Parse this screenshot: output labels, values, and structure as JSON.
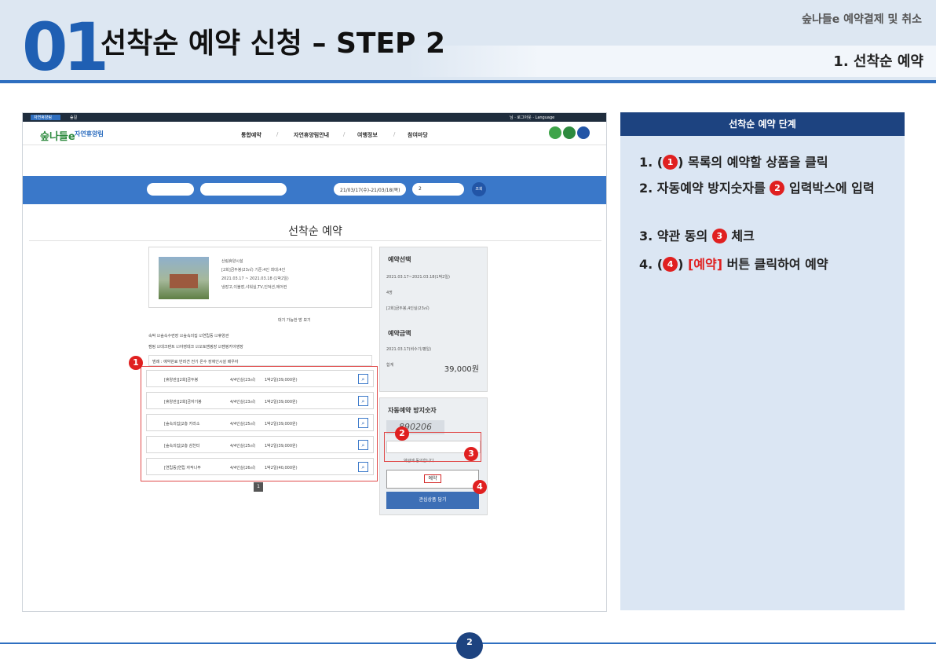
{
  "header": {
    "number": "01",
    "title": "선착순 예약 신청 – STEP 2",
    "subtitle": "숲나들e 예약결제 및 취소",
    "section": "1. 선착순 예약"
  },
  "screenshot": {
    "top_menu": [
      "자연휴양림",
      "숲길"
    ],
    "top_right": "님 · 로그아웃 · Language",
    "logo": "숲나들e",
    "site_name": "자연휴양림",
    "nav": [
      "통합예약",
      "자연휴양림안내",
      "여행정보",
      "참여마당"
    ],
    "search_dates": "21/03/17(수)-21/03/18(목)",
    "search_people": "2",
    "search_button": "조회",
    "page_heading": "선착순 예약",
    "card": {
      "forest_label": "산림휴양시설",
      "facility_label": "시설",
      "facility_value": "[2회]금두봉(23㎡) 기준:4인 최대:4인",
      "stay_label": "숙박기간",
      "stay_value": "2021.03.17 ~ 2021.03.18 (1박2일)",
      "amenity_label": "편의시설",
      "amenity_value": "냉장고,이불장,샤워실,TV,인덕션,에어컨"
    },
    "reservation_select": {
      "heading": "예약선택",
      "use_date_label": "이용일",
      "use_date": "2021.03.17~2021.03.18(1박2일)",
      "people_label": "기준인원",
      "people": "4명",
      "facility_label": "시설",
      "facility": "[2회]금두봉,4인실(23㎡)"
    },
    "reservation_amount": {
      "heading": "예약금액",
      "line": "2021.03.17(비수기/평일)",
      "line_price": "39,000원",
      "total_label": "합계",
      "total": "39,000원"
    },
    "waiting_checkbox": "대기 가능한 방 보기",
    "sort_select": "상품명별순",
    "filter_lodging": "숙박  ☑숲속수련장 ☑숲속의집 ☑연립동 ☑휴양관",
    "filter_camp": "캠핑  ☑데크텐트 ☑야영데크 ☑오토캠핑장 ☑캠핑카야영장",
    "filter_all": "☑전체",
    "legend": "범례 :  예약완료   반려견   전기   온수   장애인시설   배우자",
    "rows": [
      {
        "name": "[휴양관][2회]금두봉",
        "cap": "4/4인실(23㎡)",
        "price": "1박2일(39,000원)"
      },
      {
        "name": "[휴양관][2회]금자기봉",
        "cap": "4/4인실(23㎡)",
        "price": "1박2일(39,000원)"
      },
      {
        "name": "[숲속의집]2층 카라소",
        "cap": "4/4인실(25㎡)",
        "price": "1박2일(39,000원)"
      },
      {
        "name": "[숲속의집]2층 삼천터",
        "cap": "4/4인실(25㎡)",
        "price": "1박2일(39,000원)"
      },
      {
        "name": "[연립동]연립 자작나무",
        "cap": "4/4인실(26㎡)",
        "price": "1박2일(40,000원)"
      }
    ],
    "page": "1",
    "captcha_heading": "자동예약 방지숫자",
    "captcha_value": "890206",
    "agree_text": "약관에 동의합니다.",
    "reserve_button": "예약",
    "cart_button": "관심상품 담기",
    "markers": [
      "1",
      "2",
      "3",
      "4"
    ]
  },
  "panel": {
    "heading": "선착순 예약 단계",
    "steps": [
      {
        "pre": "1. (",
        "badge": "1",
        "post": ") 목록의 예약할 상품을 클릭"
      },
      {
        "pre": "2. 자동예약 방지숫자를 ",
        "badge": "2",
        "post": " 입력박스에 입력"
      },
      {
        "pre": "3. 약관 동의 ",
        "badge": "3",
        "post": " 체크"
      },
      {
        "pre": "4. (",
        "badge": "4",
        "post": ") ",
        "red": "[예약]",
        "post2": " 버튼 클릭하여 예약"
      }
    ]
  },
  "footer": {
    "page_number": "2"
  },
  "colors": {
    "accent": "#2f6fc0",
    "dark_navy": "#1d4380",
    "marker_red": "#e02020",
    "header_bg": "#dde7f2"
  }
}
